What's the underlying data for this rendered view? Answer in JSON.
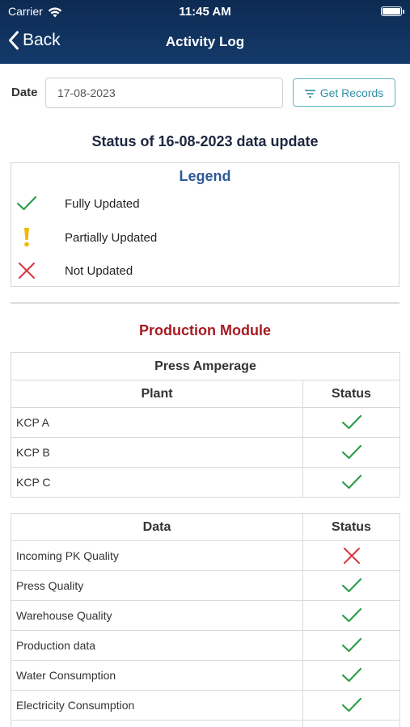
{
  "status_bar": {
    "carrier": "Carrier",
    "time": "11:45 AM"
  },
  "nav": {
    "back_label": "Back",
    "title": "Activity Log"
  },
  "filter": {
    "date_label": "Date",
    "date_value": "17-08-2023",
    "get_records_label": "Get Records"
  },
  "status_title": "Status of 16-08-2023 data update",
  "legend": {
    "title": "Legend",
    "items": [
      {
        "icon": "check-icon",
        "label": "Fully Updated",
        "color": "#2e9e4a"
      },
      {
        "icon": "exclamation-icon",
        "label": "Partially Updated",
        "color": "#f2b705"
      },
      {
        "icon": "cross-icon",
        "label": "Not Updated",
        "color": "#d9343f"
      }
    ]
  },
  "module": {
    "title": "Production Module",
    "press_amperage": {
      "caption": "Press Amperage",
      "headers": [
        "Plant",
        "Status"
      ],
      "rows": [
        {
          "name": "KCP A",
          "status": "check-icon"
        },
        {
          "name": "KCP B",
          "status": "check-icon"
        },
        {
          "name": "KCP C",
          "status": "check-icon"
        }
      ]
    },
    "data_table": {
      "headers": [
        "Data",
        "Status"
      ],
      "rows": [
        {
          "name": "Incoming PK Quality",
          "status": "cross-icon"
        },
        {
          "name": "Press Quality",
          "status": "check-icon"
        },
        {
          "name": "Warehouse Quality",
          "status": "check-icon"
        },
        {
          "name": "Production data",
          "status": "check-icon"
        },
        {
          "name": "Water Consumption",
          "status": "check-icon"
        },
        {
          "name": "Electricity Consumption",
          "status": "check-icon"
        }
      ]
    }
  }
}
